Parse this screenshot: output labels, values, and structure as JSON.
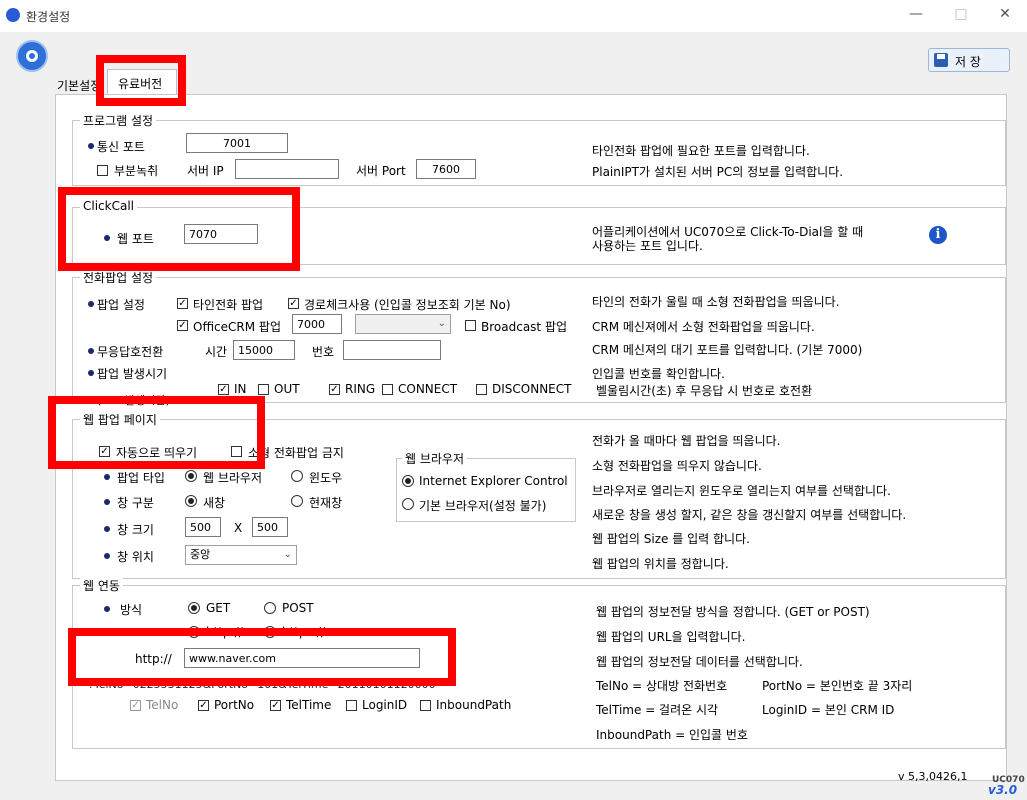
{
  "window": {
    "title": "환경설정",
    "minimize": "—",
    "maximize": "□",
    "close": "✕"
  },
  "save_button": "저   장",
  "tabs": [
    {
      "label": "기본설정"
    },
    {
      "label": "유료버전"
    }
  ],
  "program": {
    "legend": "프로그램 설정",
    "comm_port_label": "통신 포트",
    "comm_port_value": "7001",
    "partial_rec_label": "부분녹취",
    "server_ip_label": "서버 IP",
    "server_ip_value": "",
    "server_port_label": "서버 Port",
    "server_port_value": "7600",
    "desc1": "타인전화 팝업에 필요한 포트를 입력합니다.",
    "desc2": "PlainIPT가 설치된 서버 PC의 정보를 입력합니다."
  },
  "clickcall": {
    "legend": "ClickCall",
    "web_port_label": "웹 포트",
    "web_port_value": "7070",
    "desc_line1": "어플리케이션에서 UC070으로 Click-To-Dial을 할 때",
    "desc_line2": "사용하는 포트 입니다."
  },
  "popup": {
    "legend": "전화팝업 설정",
    "popup_setting_label": "팝업 설정",
    "other_call_popup": "타인전화 팝업",
    "route_check": "경로체크사용 (인입콜 정보조회 기본 No)",
    "officecrm_popup": "OfficeCRM 팝업",
    "officecrm_port": "7000",
    "broadcast_popup": "Broadcast 팝업",
    "no_answer_label": "무응답호전환",
    "time_label": "시간",
    "time_value": "15000",
    "number_label": "번호",
    "number_value": "",
    "popup_time_label": "팝업 발생시기",
    "popup_time_sub": "(EPP 발생시간)",
    "in": "IN",
    "out": "OUT",
    "ring": "RING",
    "connect": "CONNECT",
    "disconnect": "DISCONNECT",
    "ring_desc": "벨울림시간(초) 후 무응답 시 번호로 호전환",
    "desc1": "타인의 전화가 울릴 때 소형 전화팝업을 띄웁니다.",
    "desc2": "CRM 메신져에서 소형 전화팝업을 띄웁니다.",
    "desc3": "CRM 메신져의 대기 포트를 입력합니다. (기본 7000)",
    "desc4": "인입콜 번호를 확인합니다."
  },
  "webpopup": {
    "legend": "웹 팝업 페이지",
    "auto_open": "자동으로 띄우기",
    "no_small_popup": "소형 전화팝업 금지",
    "popup_type_label": "팝업 타입",
    "type_browser": "웹 브라우저",
    "type_window": "윈도우",
    "window_label": "창 구분",
    "new_window": "새창",
    "current_window": "현재창",
    "size_label": "창 크기",
    "width_value": "500",
    "x_label": "X",
    "height_value": "500",
    "pos_label": "창 위치",
    "pos_value": "중앙",
    "browser_legend": "웹 브라우저",
    "ie_control": "Internet Explorer Control",
    "default_browser": "기본 브라우저(설정 불가)",
    "desc1": "전화가 올 때마다 웹 팝업을 띄웁니다.",
    "desc2": "소형 전화팝업을 띄우지 않습니다.",
    "desc3": "브라우저로 열리는지 윈도우로 열리는지 여부를 선택합니다.",
    "desc4": "새로운 창을 생성 할지, 같은 창을 갱신할지 여부를 선택합니다.",
    "desc5": "웹 팝업의 Size 를 입력 합니다.",
    "desc6": "웹 팝업의 위치를 정합니다."
  },
  "weblink": {
    "legend": "웹 연동",
    "method_label": "방식",
    "get": "GET",
    "post": "POST",
    "http_radio": "http://",
    "https_radio": "https://",
    "url_prefix": "http://",
    "url_value": "www.naver.com",
    "sample_query": "?TelNo=0225531125&PortNo=101&TelTime=20110101120000",
    "telno": "TelNo",
    "portno": "PortNo",
    "teltime": "TelTime",
    "loginid": "LoginID",
    "inboundpath": "InboundPath",
    "desc1": "웹 팝업의 정보전달 방식을 정합니다. (GET or POST)",
    "desc2": "웹 팝업의 URL을 입력합니다.",
    "desc3": "웹 팝업의 정보전달 데이터를 선택합니다.",
    "telno_desc": "TelNo = 상대방 전화번호",
    "portno_desc": "PortNo = 본인번호 끝 3자리",
    "teltime_desc": "TelTime = 걸려온 시각",
    "loginid_desc": "LoginID = 본인 CRM ID",
    "inbound_desc": "InboundPath = 인입콜 번호"
  },
  "version": "v 5,3,0426,1",
  "brand_top": "UC070",
  "brand_ver": "v3.0"
}
